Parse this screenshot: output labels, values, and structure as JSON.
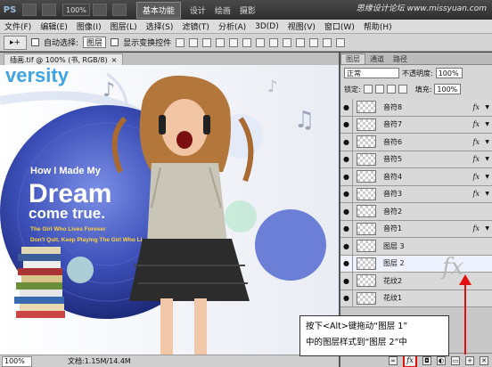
{
  "titlebar": {
    "logo": "PS",
    "zoom": "100%",
    "workspace_active": "基本功能",
    "workspaces": [
      "设计",
      "绘画",
      "摄影"
    ],
    "watermark": "思缘设计论坛 www.missyuan.com"
  },
  "menu": [
    "文件(F)",
    "编辑(E)",
    "图像(I)",
    "图层(L)",
    "选择(S)",
    "滤镜(T)",
    "分析(A)",
    "3D(D)",
    "视图(V)",
    "窗口(W)",
    "帮助(H)"
  ],
  "options": {
    "auto_select_label": "自动选择:",
    "auto_select_value": "图层",
    "show_transform_label": "显示变换控件"
  },
  "document": {
    "tab_title": "插画.tif @ 100% (书, RGB/8)",
    "close": "×",
    "zoom": "100%",
    "doc_info": "文档:1.15M/14.4M"
  },
  "artwork": {
    "logo_text": "versity",
    "headline1": "How I Made My",
    "headline2": "Dream",
    "headline3": "come true.",
    "sub1": "The Girl Who Lives Forever",
    "sub2": "Don't Quit. Keep Playing The Girl Who Li"
  },
  "layers_panel": {
    "tabs": [
      "图层",
      "通道",
      "路径"
    ],
    "blend_mode": "正常",
    "opacity_label": "不透明度:",
    "opacity_value": "100%",
    "lock_label": "锁定:",
    "fill_label": "填充:",
    "fill_value": "100%",
    "layers": [
      {
        "name": "音符8",
        "fx": true
      },
      {
        "name": "音符7",
        "fx": true
      },
      {
        "name": "音符6",
        "fx": true
      },
      {
        "name": "音符5",
        "fx": true
      },
      {
        "name": "音符4",
        "fx": true
      },
      {
        "name": "音符3",
        "fx": true
      },
      {
        "name": "音符2",
        "fx": false
      },
      {
        "name": "音符1",
        "fx": true
      },
      {
        "name": "图层 3",
        "fx": false
      },
      {
        "name": "图层 2",
        "fx": false
      },
      {
        "name": "花纹2",
        "fx": false
      },
      {
        "name": "花纹1",
        "fx": false
      }
    ],
    "fx_symbol": "fx"
  },
  "callout": {
    "line1": "按下<Alt>键拖动“图层 1”",
    "line2": "中的图层样式到“图层 2”中"
  },
  "colors": {
    "highlight_red": "#e01010",
    "circle_blue": "#6c7fd6"
  }
}
